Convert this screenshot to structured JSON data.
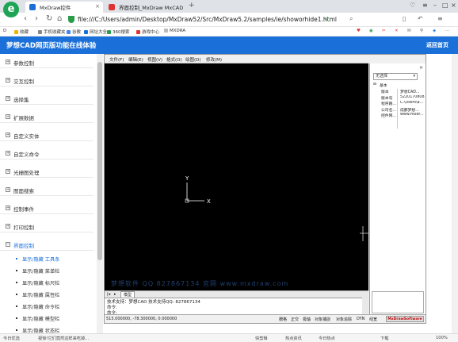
{
  "browser": {
    "tabs": [
      {
        "title": "MxDraw控件",
        "active": true
      },
      {
        "title": "界面控制_MxDraw MxCAD",
        "active": false
      }
    ],
    "new_tab": "+",
    "url": "file:///C:/Users/admin/Desktop/MxDraw52/Src/MxDraw5.2/samples/ie/showorhide1.html",
    "bookmarks": [
      "D",
      "收藏",
      "手机收藏夹",
      "谷歌",
      "网址大全",
      "360搜索",
      "游戏中心",
      "MXDRA"
    ]
  },
  "page": {
    "title": "梦想CAD网页版功能在线体验",
    "home_link": "返回首页"
  },
  "menu": {
    "items": [
      {
        "label": "参数控制",
        "expanded": false
      },
      {
        "label": "交互控制",
        "expanded": false
      },
      {
        "label": "选择集",
        "expanded": false
      },
      {
        "label": "扩展数据",
        "expanded": false
      },
      {
        "label": "自定义实体",
        "expanded": false
      },
      {
        "label": "自定义命令",
        "expanded": false
      },
      {
        "label": "光栅图处理",
        "expanded": false
      },
      {
        "label": "图面搜索",
        "expanded": false
      },
      {
        "label": "控制事件",
        "expanded": false
      },
      {
        "label": "打印控制",
        "expanded": false
      },
      {
        "label": "界面控制",
        "expanded": true
      }
    ],
    "subitems": [
      {
        "label": "显示/隐藏 工具条",
        "active": true
      },
      {
        "label": "显示/隐藏 菜单栏",
        "active": false
      },
      {
        "label": "显示/隐藏 标尺栏",
        "active": false
      },
      {
        "label": "显示/隐藏 属性栏",
        "active": false
      },
      {
        "label": "显示/隐藏 命令栏",
        "active": false
      },
      {
        "label": "显示/隐藏 模型栏",
        "active": false
      },
      {
        "label": "显示/隐藏 状态栏",
        "active": false
      }
    ]
  },
  "cad": {
    "menus": [
      "文件(F)",
      "编辑(E)",
      "视图(V)",
      "格式(O)",
      "绘图(D)",
      "修改(M)"
    ],
    "axis_y": "Y",
    "axis_x": "X",
    "watermark": "梦想软件  QQ 827867134  官网  www.mxdraw.com",
    "model_tabs": [
      "模型"
    ],
    "command_lines": [
      "技术支持：梦想CAD 技术支持QQ: 827867134",
      "命令:",
      "命令:"
    ],
    "coords": "515.000000,  -78.300000,  0.000000",
    "status_toggles": [
      "栅格",
      "正交",
      "极轴",
      "对象捕捉",
      "对象追踪",
      "DYN",
      "线宽"
    ],
    "status_logo": "MxDrawSoftware"
  },
  "props": {
    "select_value": "无选择",
    "group": "基本",
    "rows": [
      {
        "key": "版本",
        "value": "梦想CAD..."
      },
      {
        "key": "版本号",
        "value": "5220170808"
      },
      {
        "key": "程序路...",
        "value": "C:\\Users\\a..."
      },
      {
        "key": "公司名...",
        "value": "成都梦想..."
      },
      {
        "key": "控件网...",
        "value": "www.mxdr..."
      }
    ]
  },
  "bottom_status": {
    "left": [
      "今日优选",
      "视惊!它们竟然这样来吃掉..."
    ],
    "right": [
      "快剪辑",
      "热点资讯",
      "今日热点",
      "下载",
      "100%"
    ]
  }
}
